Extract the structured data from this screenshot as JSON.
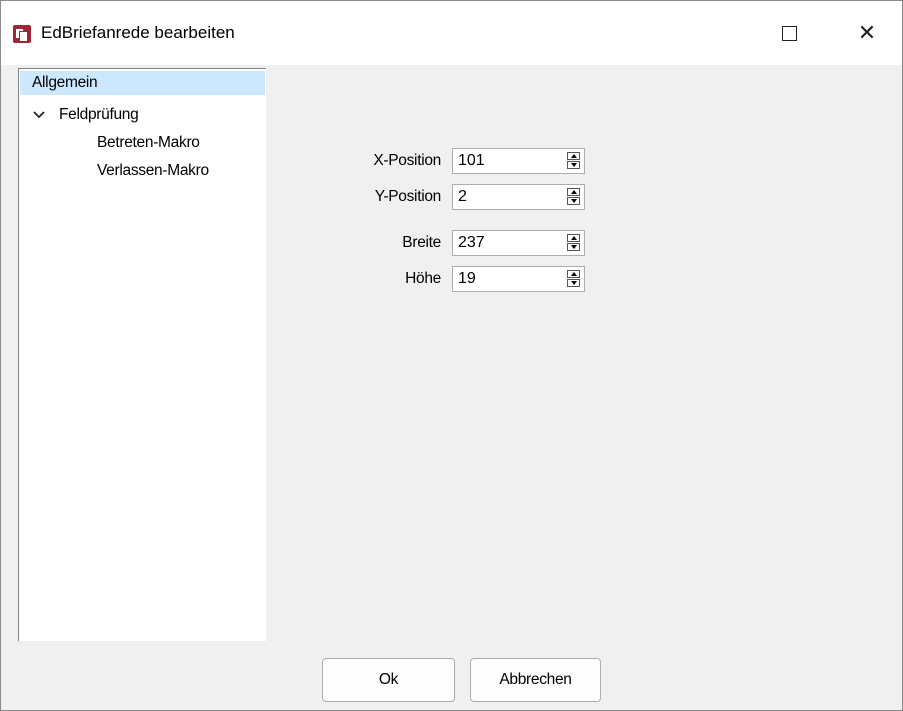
{
  "window": {
    "title": "EdBriefanrede bearbeiten",
    "icon": "app-document-icon",
    "controls": {
      "maximize_icon": "maximize-icon",
      "close_icon": "close-icon",
      "close_glyph": "✕"
    }
  },
  "tree": {
    "items": [
      {
        "label": "Allgemein",
        "selected": true
      },
      {
        "label": "Feldprüfung",
        "expanded": true,
        "expander_icon": "chevron-down-icon"
      },
      {
        "label": "Betreten-Makro"
      },
      {
        "label": "Verlassen-Makro"
      }
    ]
  },
  "fields": {
    "x_position": {
      "label": "X-Position",
      "value": "101"
    },
    "y_position": {
      "label": "Y-Position",
      "value": "2"
    },
    "breite": {
      "label": "Breite",
      "value": "237"
    },
    "hoehe": {
      "label": "Höhe",
      "value": "19"
    }
  },
  "buttons": {
    "ok": "Ok",
    "cancel": "Abbrechen"
  },
  "colors": {
    "selection": "#cce8ff",
    "app_icon": "#a0243a",
    "dialog_bg": "#f0f0f0"
  }
}
